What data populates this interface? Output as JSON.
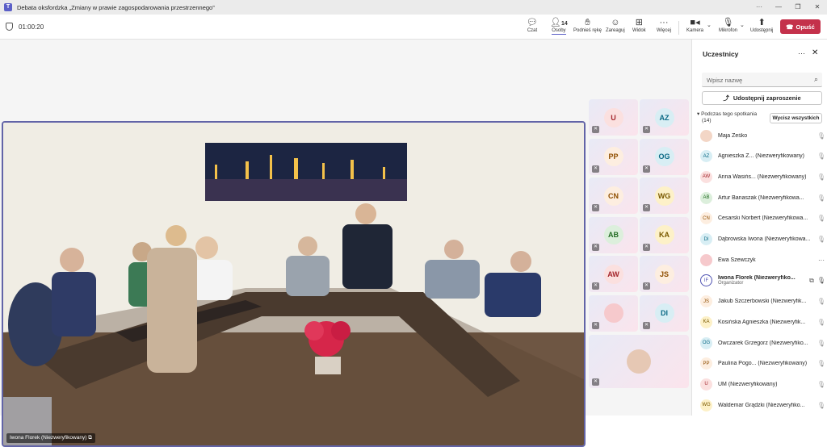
{
  "window": {
    "title": "Debata oksfordzka „Zmiany w prawie zagospodarowania przestrzennego”"
  },
  "toolbar": {
    "timer": "01:00:20",
    "chat": "Czat",
    "people": "Osoby",
    "people_count": "14",
    "raise_hand": "Podnieś rękę",
    "react": "Zareaguj",
    "view": "Widok",
    "more": "Więcej",
    "camera": "Kamera",
    "mic": "Mikrofon",
    "share": "Udostępnij",
    "leave": "Opuść"
  },
  "main_video": {
    "name": "Iwona Florek (Niezweryfikowany)"
  },
  "tiles": [
    {
      "initials": "U",
      "bg": "#fbe0df",
      "fg": "#a4262c"
    },
    {
      "initials": "AZ",
      "bg": "#d8eef4",
      "fg": "#0b6a85"
    },
    {
      "initials": "PP",
      "bg": "#fdeee0",
      "fg": "#8f4e00"
    },
    {
      "initials": "OG",
      "bg": "#d8eef4",
      "fg": "#0b6a85"
    },
    {
      "initials": "CN",
      "bg": "#fdeee0",
      "fg": "#8f4e00"
    },
    {
      "initials": "WG",
      "bg": "#fdf1c8",
      "fg": "#7a5900"
    },
    {
      "initials": "AB",
      "bg": "#dcefdc",
      "fg": "#256d25"
    },
    {
      "initials": "KA",
      "bg": "#fdf1c8",
      "fg": "#7a5900"
    },
    {
      "initials": "AW",
      "bg": "#fbe0df",
      "fg": "#a4262c"
    },
    {
      "initials": "JS",
      "bg": "#fdeee0",
      "fg": "#8f4e00"
    },
    {
      "initials": "",
      "bg": "#f6c9cc",
      "fg": "#a4262c"
    },
    {
      "initials": "DI",
      "bg": "#d8eef4",
      "fg": "#0b6a85"
    }
  ],
  "panel": {
    "title": "Uczestnicy",
    "search_placeholder": "Wpisz nazwę",
    "share_invite": "Udostępnij zaproszenie",
    "section_label": "Podczas tego spotkania",
    "section_count": "(14)",
    "mute_all": "Wycisz wszystkich",
    "participants": [
      {
        "initials": "",
        "name": "Maja Żeśko",
        "role": "",
        "bg": "#f3d6c6",
        "fg": "#7a3b1d"
      },
      {
        "initials": "AZ",
        "name": "Agnieszka Z... (Niezweryfikowany)",
        "role": "",
        "bg": "#d8eef4",
        "fg": "#0b6a85"
      },
      {
        "initials": "AW",
        "name": "Anna Wasińs... (Niezweryfikowany)",
        "role": "",
        "bg": "#fbe0df",
        "fg": "#a4262c"
      },
      {
        "initials": "AB",
        "name": "Artur Banaszak (Niezweryfikowa...",
        "role": "",
        "bg": "#dcefdc",
        "fg": "#256d25"
      },
      {
        "initials": "CN",
        "name": "Cesarski Norbert (Niezweryfikowa...",
        "role": "",
        "bg": "#fdeee0",
        "fg": "#8f4e00"
      },
      {
        "initials": "DI",
        "name": "Dąbrowska Iwona (Niezweryfikowa...",
        "role": "",
        "bg": "#d8eef4",
        "fg": "#0b6a85"
      },
      {
        "initials": "",
        "name": "Ewa Szewczyk",
        "role": "",
        "bg": "#f6c9cc",
        "fg": "#a4262c"
      },
      {
        "initials": "IF",
        "name": "Iwona Florek (Niezweryfiko...",
        "role": "Organizator",
        "bg": "#ffffff",
        "fg": "#4f52b2"
      },
      {
        "initials": "JS",
        "name": "Jakub Szczerbowski (Niezweryfik...",
        "role": "",
        "bg": "#fdeee0",
        "fg": "#8f4e00"
      },
      {
        "initials": "KA",
        "name": "Kosińska Agnieszka (Niezweryfik...",
        "role": "",
        "bg": "#fdf1c8",
        "fg": "#7a5900"
      },
      {
        "initials": "OG",
        "name": "Owczarek Grzegorz (Niezweryfiko...",
        "role": "",
        "bg": "#d8eef4",
        "fg": "#0b6a85"
      },
      {
        "initials": "PP",
        "name": "Paulina Pogo... (Niezweryfikowany)",
        "role": "",
        "bg": "#fdeee0",
        "fg": "#8f4e00"
      },
      {
        "initials": "U",
        "name": "UM (Niezweryfikowany)",
        "role": "",
        "bg": "#fbe0df",
        "fg": "#a4262c"
      },
      {
        "initials": "WG",
        "name": "Waldemar Grądzki (Niezweryfiko...",
        "role": "",
        "bg": "#fdf1c8",
        "fg": "#7a5900"
      }
    ]
  }
}
